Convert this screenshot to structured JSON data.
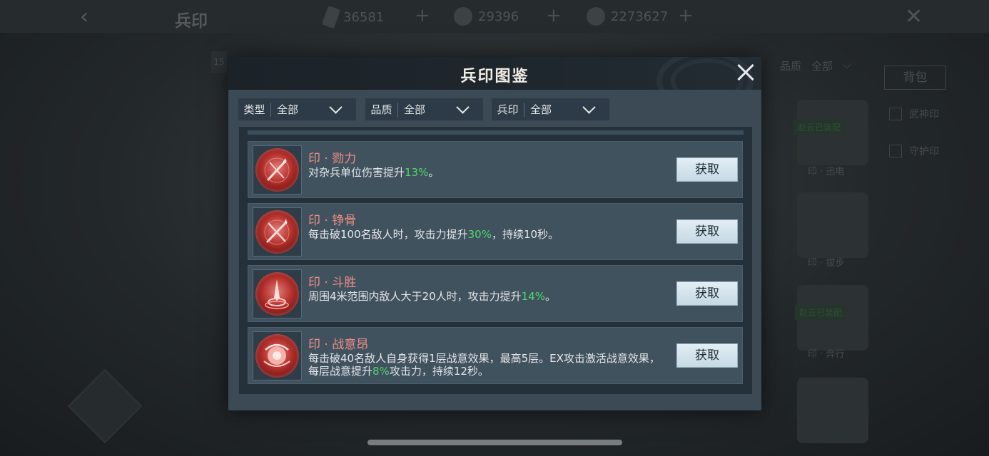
{
  "background": {
    "title": "兵印",
    "resources": [
      {
        "icon": "ticket-icon",
        "value": "36581"
      },
      {
        "icon": "ingot-icon",
        "value": "29396"
      },
      {
        "icon": "coin-icon",
        "value": "2273627"
      }
    ],
    "badge": "15",
    "filter_quality_label": "品质",
    "filter_quality_value": "全部",
    "bag_label": "背包",
    "checkboxes": [
      "武神印",
      "守护印"
    ],
    "equipped_tags": [
      "赵云已装配",
      "赵云已装配"
    ],
    "card_captions": [
      "印 · 迅电",
      "印 · 拔步",
      "印 · 奔行"
    ]
  },
  "modal": {
    "title": "兵印图鉴",
    "filters": [
      {
        "label": "类型",
        "value": "全部"
      },
      {
        "label": "品质",
        "value": "全部"
      },
      {
        "label": "兵印",
        "value": "全部"
      }
    ],
    "items": [
      {
        "name": "印 · 勠力",
        "desc_before": "对杂兵单位伤害提升",
        "desc_highlight": "13%",
        "desc_after": "。",
        "button": "获取",
        "icon": "crossed-swords-icon"
      },
      {
        "name": "印 · 铮骨",
        "desc_before": "每击破100名敌人时，攻击力提升",
        "desc_highlight": "30%",
        "desc_after": "，持续10秒。",
        "button": "获取",
        "icon": "crossed-swords-icon"
      },
      {
        "name": "印 · 斗胜",
        "desc_before": "周围4米范围内敌人大于20人时，攻击力提升",
        "desc_highlight": "14%",
        "desc_after": "。",
        "button": "获取",
        "icon": "blade-icon"
      },
      {
        "name": "印 · 战意昂",
        "desc_before": "每击破40名敌人自身获得1层战意效果，最高5层。EX攻击激活战意效果，每层战意提升",
        "desc_highlight": "8%",
        "desc_after": "攻击力，持续12秒。",
        "button": "获取",
        "icon": "fist-aura-icon"
      }
    ]
  },
  "colors": {
    "accent_name": "#f08d84",
    "highlight": "#4fd66a",
    "panel": "#3b4a55"
  }
}
